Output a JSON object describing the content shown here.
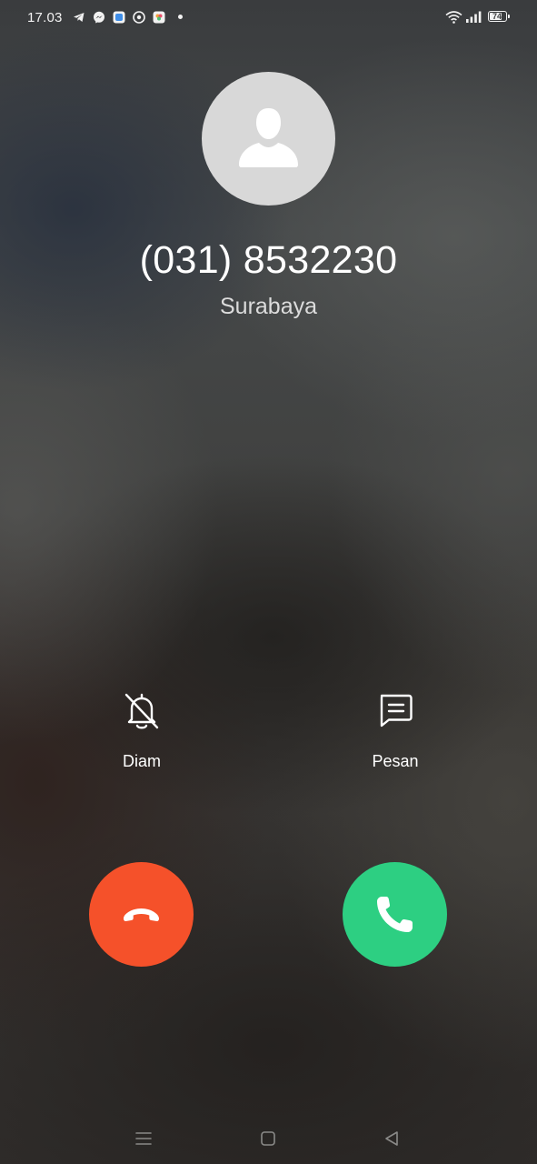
{
  "status_bar": {
    "time": "17.03",
    "notification_icons": [
      "telegram-icon",
      "messenger-icon",
      "app-icon",
      "app-icon",
      "photos-icon"
    ],
    "battery_level": "74",
    "wifi": true,
    "signal_bars": 4
  },
  "caller": {
    "number": "(031) 8532230",
    "location": "Surabaya",
    "avatar_icon": "person-icon"
  },
  "actions": {
    "silence_label": "Diam",
    "message_label": "Pesan"
  },
  "call_buttons": {
    "decline_color": "#f5512a",
    "accept_color": "#2dcf82"
  },
  "nav_bar": {
    "items": [
      "menu-icon",
      "home-icon",
      "back-icon"
    ]
  }
}
